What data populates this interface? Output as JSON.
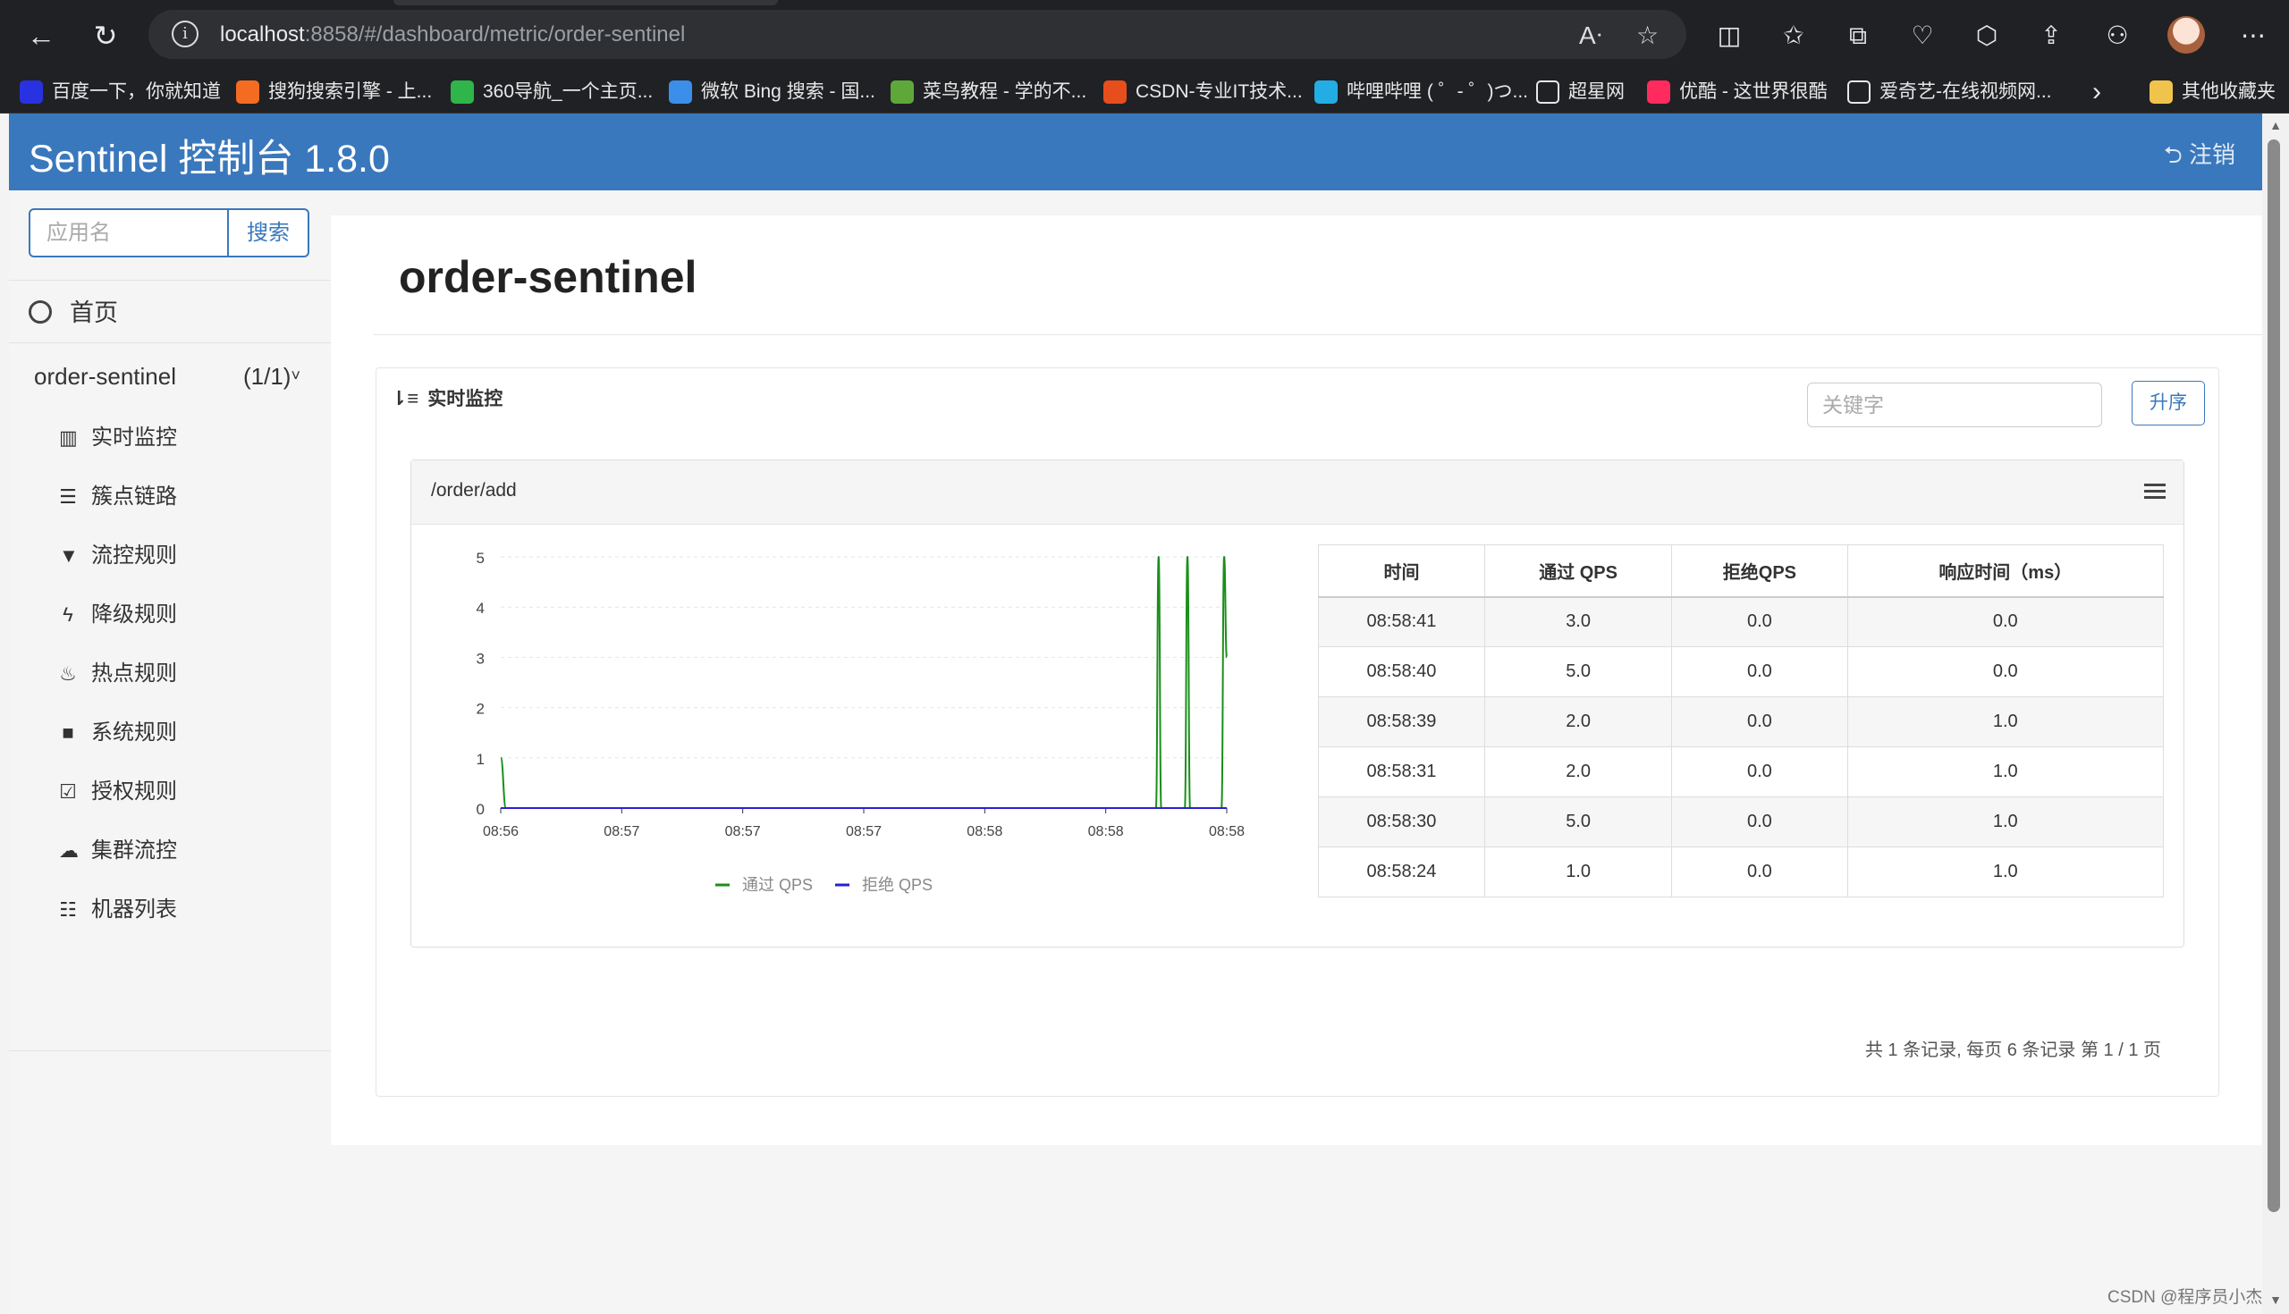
{
  "browser": {
    "url_host": "localhost",
    "url_rest": ":8858/#/dashboard/metric/order-sentinel",
    "bookmarks": [
      {
        "label": "百度一下，你就知道",
        "icon": "baidu-icon",
        "color": "#2932e1"
      },
      {
        "label": "搜狗搜索引擎 - 上...",
        "icon": "sogou-icon",
        "color": "#f36c21"
      },
      {
        "label": "360导航_一个主页...",
        "icon": "360-icon",
        "color": "#2fb54a"
      },
      {
        "label": "微软 Bing 搜索 - 国...",
        "icon": "bing-search-icon",
        "color": "#3b8eea"
      },
      {
        "label": "菜鸟教程 - 学的不...",
        "icon": "runoob-icon",
        "color": "#5ea83a"
      },
      {
        "label": "CSDN-专业IT技术...",
        "icon": "csdn-icon",
        "color": "#e84e1b"
      },
      {
        "label": "哔哩哔哩 ( ゜- ゜)つ...",
        "icon": "bilibili-icon",
        "color": "#23ade5"
      },
      {
        "label": "超星网",
        "icon": "page-icon",
        "color": "#e8e8e8"
      },
      {
        "label": "优酷 - 这世界很酷",
        "icon": "youku-icon",
        "color": "#ff2a5e"
      },
      {
        "label": "爱奇艺-在线视频网...",
        "icon": "page-icon",
        "color": "#e8e8e8"
      }
    ],
    "other_bookmarks": "其他收藏夹"
  },
  "app": {
    "brand": "Sentinel 控制台 1.8.0",
    "logout": "注销"
  },
  "sidebar": {
    "search_placeholder": "应用名",
    "search_button": "搜索",
    "home": "首页",
    "app_name": "order-sentinel",
    "app_count": "(1/1)",
    "menu": [
      {
        "label": "实时监控",
        "icon": "bar-chart-icon",
        "glyph": "▥"
      },
      {
        "label": "簇点链路",
        "icon": "list-alt-icon",
        "glyph": "☰"
      },
      {
        "label": "流控规则",
        "icon": "filter-icon",
        "glyph": "▼"
      },
      {
        "label": "降级规则",
        "icon": "flash-icon",
        "glyph": "ϟ"
      },
      {
        "label": "热点规则",
        "icon": "fire-icon",
        "glyph": "♨"
      },
      {
        "label": "系统规则",
        "icon": "lock-icon",
        "glyph": "■"
      },
      {
        "label": "授权规则",
        "icon": "check-icon",
        "glyph": "☑"
      },
      {
        "label": "集群流控",
        "icon": "cloud-icon",
        "glyph": "☁"
      },
      {
        "label": "机器列表",
        "icon": "th-list-icon",
        "glyph": "☷"
      }
    ]
  },
  "main": {
    "title": "order-sentinel",
    "panel_title": "实时监控",
    "keyword_placeholder": "关键字",
    "sort_button": "升序",
    "resource": "/order/add",
    "pager": "共 1 条记录, 每页 6 条记录 第 1 / 1 页"
  },
  "table": {
    "headers": [
      "时间",
      "通过 QPS",
      "拒绝QPS",
      "响应时间（ms）"
    ],
    "rows": [
      [
        "08:58:41",
        "3.0",
        "0.0",
        "0.0"
      ],
      [
        "08:58:40",
        "5.0",
        "0.0",
        "0.0"
      ],
      [
        "08:58:39",
        "2.0",
        "0.0",
        "1.0"
      ],
      [
        "08:58:31",
        "2.0",
        "0.0",
        "1.0"
      ],
      [
        "08:58:30",
        "5.0",
        "0.0",
        "1.0"
      ],
      [
        "08:58:24",
        "1.0",
        "0.0",
        "1.0"
      ]
    ]
  },
  "chart_data": {
    "type": "line",
    "title": "",
    "xlabel": "",
    "ylabel": "",
    "x_ticks": [
      "08:56",
      "08:57",
      "08:57",
      "08:57",
      "08:58",
      "08:58",
      "08:58"
    ],
    "y_ticks": [
      0,
      1,
      2,
      3,
      4,
      5
    ],
    "ylim": [
      0,
      5
    ],
    "legend_position": "bottom-center",
    "series": [
      {
        "name": "通过 QPS",
        "color": "#1a8f1a",
        "points": [
          [
            0,
            1
          ],
          [
            0.4,
            0
          ],
          [
            50,
            0
          ],
          [
            50.2,
            5
          ],
          [
            50.4,
            0
          ],
          [
            52.2,
            0
          ],
          [
            52.4,
            5
          ],
          [
            52.6,
            0
          ],
          [
            55,
            0
          ],
          [
            55.2,
            5
          ],
          [
            55.4,
            3
          ]
        ]
      },
      {
        "name": "拒绝 QPS",
        "color": "#2a1fd6",
        "points": [
          [
            0,
            0
          ],
          [
            55.4,
            0
          ]
        ]
      }
    ],
    "colors": {
      "pass": "#1a8f1a",
      "block": "#2a1fd6"
    }
  }
}
